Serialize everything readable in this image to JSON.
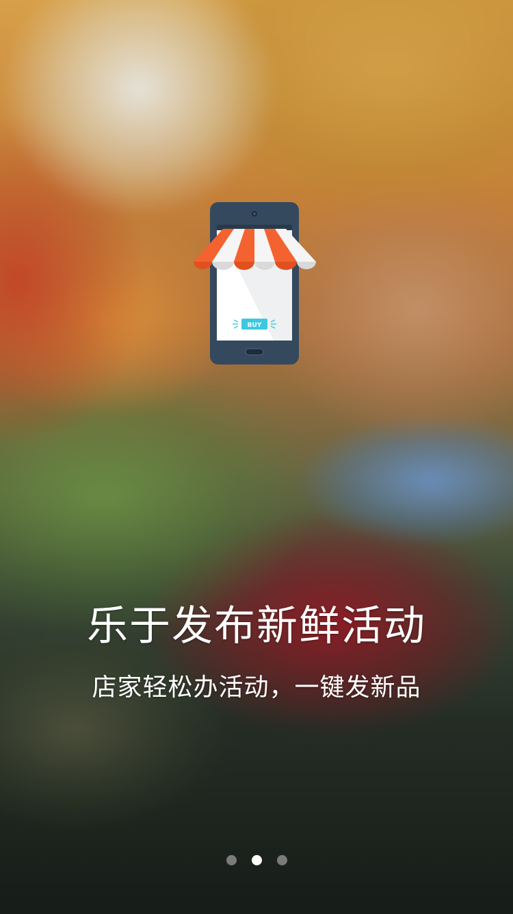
{
  "onboarding": {
    "headline": "乐于发布新鲜活动",
    "subline": "店家轻松办活动，一键发新品",
    "icon": "mobile-shop-icon",
    "buy_label": "BUY"
  },
  "pager": {
    "total": 3,
    "active_index": 1
  },
  "colors": {
    "phone_body": "#34495e",
    "awning_orange": "#f4622f",
    "awning_white": "#f5f5f5",
    "buy_button": "#3cc9e0",
    "active_dot": "#ffffff",
    "inactive_dot": "#a0a0a0"
  }
}
